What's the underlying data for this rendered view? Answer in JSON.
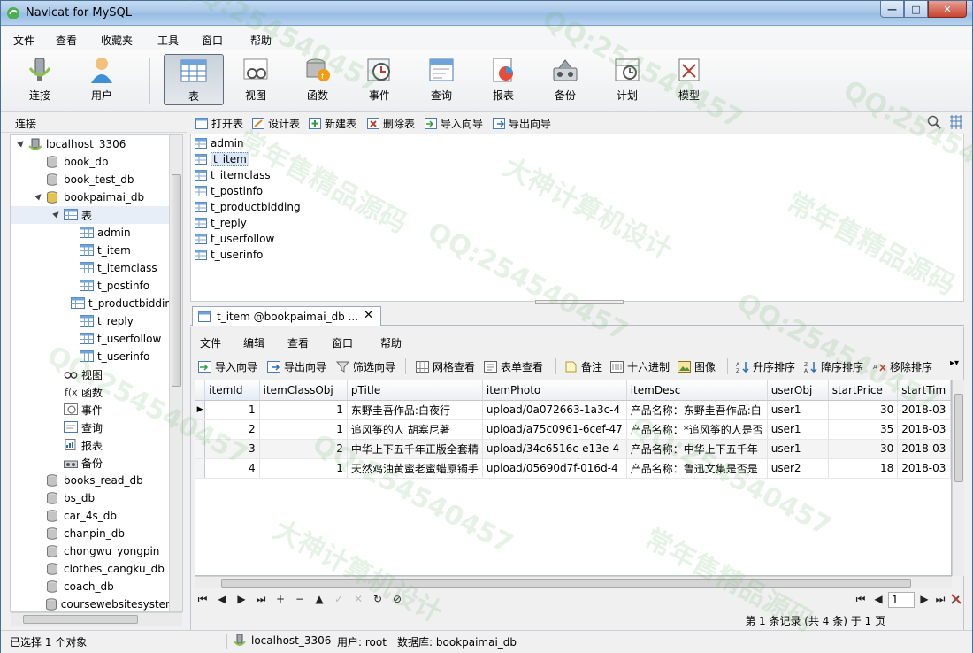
{
  "window": {
    "title": "Navicat for MySQL",
    "buttons": {
      "minimize": "—",
      "maximize": "□",
      "close": "✕"
    }
  },
  "menu": [
    "文件",
    "查看",
    "收藏夹",
    "工具",
    "窗口",
    "帮助"
  ],
  "toolbar": [
    {
      "label": "连接",
      "icon": "connection-icon"
    },
    {
      "label": "用户",
      "icon": "user-icon"
    },
    {
      "label": "表",
      "icon": "table-icon",
      "active": true
    },
    {
      "label": "视图",
      "icon": "view-icon"
    },
    {
      "label": "函数",
      "icon": "function-icon"
    },
    {
      "label": "事件",
      "icon": "event-icon"
    },
    {
      "label": "查询",
      "icon": "query-icon"
    },
    {
      "label": "报表",
      "icon": "report-icon"
    },
    {
      "label": "备份",
      "icon": "backup-icon"
    },
    {
      "label": "计划",
      "icon": "schedule-icon"
    },
    {
      "label": "模型",
      "icon": "model-icon"
    }
  ],
  "left_panel": {
    "header": "连接",
    "tree": [
      {
        "label": "localhost_3306",
        "level": 0,
        "toggle": "▲",
        "icon": "server"
      },
      {
        "label": "book_db",
        "level": 1,
        "icon": "db"
      },
      {
        "label": "book_test_db",
        "level": 1,
        "icon": "db"
      },
      {
        "label": "bookpaimai_db",
        "level": 1,
        "toggle": "▲",
        "icon": "db-open"
      },
      {
        "label": "表",
        "level": 2,
        "toggle": "▲",
        "icon": "table",
        "selected": true
      },
      {
        "label": "admin",
        "level": 3,
        "icon": "table"
      },
      {
        "label": "t_item",
        "level": 3,
        "icon": "table"
      },
      {
        "label": "t_itemclass",
        "level": 3,
        "icon": "table"
      },
      {
        "label": "t_postinfo",
        "level": 3,
        "icon": "table"
      },
      {
        "label": "t_productbidding",
        "level": 3,
        "icon": "table"
      },
      {
        "label": "t_reply",
        "level": 3,
        "icon": "table"
      },
      {
        "label": "t_userfollow",
        "level": 3,
        "icon": "table"
      },
      {
        "label": "t_userinfo",
        "level": 3,
        "icon": "table"
      },
      {
        "label": "视图",
        "level": 2,
        "icon": "view"
      },
      {
        "label": "函数",
        "level": 2,
        "icon": "function"
      },
      {
        "label": "事件",
        "level": 2,
        "icon": "event"
      },
      {
        "label": "查询",
        "level": 2,
        "icon": "query"
      },
      {
        "label": "报表",
        "level": 2,
        "icon": "report"
      },
      {
        "label": "备份",
        "level": 2,
        "icon": "backup"
      },
      {
        "label": "books_read_db",
        "level": 1,
        "icon": "db"
      },
      {
        "label": "bs_db",
        "level": 1,
        "icon": "db"
      },
      {
        "label": "car_4s_db",
        "level": 1,
        "icon": "db"
      },
      {
        "label": "chanpin_db",
        "level": 1,
        "icon": "db"
      },
      {
        "label": "chongwu_yongpin",
        "level": 1,
        "icon": "db"
      },
      {
        "label": "clothes_cangku_db",
        "level": 1,
        "icon": "db"
      },
      {
        "label": "coach_db",
        "level": 1,
        "icon": "db"
      },
      {
        "label": "coursewebsitesyster",
        "level": 1,
        "icon": "db"
      }
    ]
  },
  "object_toolbar": [
    "打开表",
    "设计表",
    "新建表",
    "删除表",
    "导入向导",
    "导出向导"
  ],
  "object_list": [
    "admin",
    "t_item",
    "t_itemclass",
    "t_postinfo",
    "t_productbidding",
    "t_reply",
    "t_userfollow",
    "t_userinfo"
  ],
  "selected_object": "t_item",
  "tab": {
    "label": "t_item @bookpaimai_db ...",
    "close": "✕"
  },
  "inner_menu": [
    "文件",
    "编辑",
    "查看",
    "窗口",
    "帮助"
  ],
  "inner_toolbar": [
    "导入向导",
    "导出向导",
    "筛选向导",
    "网格查看",
    "表单查看",
    "备注",
    "十六进制",
    "图像",
    "升序排序",
    "降序排序",
    "移除排序"
  ],
  "grid": {
    "columns": [
      "itemId",
      "itemClassObj",
      "pTitle",
      "itemPhoto",
      "itemDesc",
      "userObj",
      "startPrice",
      "startTim"
    ],
    "rows": [
      [
        "1",
        "1",
        "东野圭吾作品:白夜行",
        "upload/0a072663-1a3c-4",
        "产品名称：东野圭吾作品:白",
        "user1",
        "30",
        "2018-03"
      ],
      [
        "2",
        "1",
        "追风筝的人 胡塞尼著",
        "upload/a75c0961-6cef-47",
        "产品名称：*追风筝的人是否",
        "user1",
        "35",
        "2018-03"
      ],
      [
        "3",
        "2",
        "中华上下五千年正版全套精",
        "upload/34c6516c-e13e-4",
        "产品名称：中华上下五千年",
        "user1",
        "30",
        "2018-03"
      ],
      [
        "4",
        "1",
        "天然鸡油黄蜜老蜜蜡原镯手",
        "upload/05690d7f-016d-4",
        "产品名称：鲁迅文集是否是",
        "user2",
        "18",
        "2018-03"
      ]
    ],
    "current_row": 0
  },
  "nav": {
    "buttons": [
      "⏮",
      "◀",
      "▶",
      "⏭",
      "+",
      "−",
      "▲",
      "✓",
      "✕",
      "↻",
      "⊘"
    ],
    "page": "1",
    "record_status": "第 1 条记录 (共 4 条) 于 1 页"
  },
  "status": {
    "selection": "已选择 1 个对象",
    "connection": "localhost_3306",
    "user": "用户: root",
    "database": "数据库: bookpaimai_db"
  },
  "watermarks": [
    "QQ:254540457",
    "大神计算机设计",
    "常年售精品源码"
  ]
}
